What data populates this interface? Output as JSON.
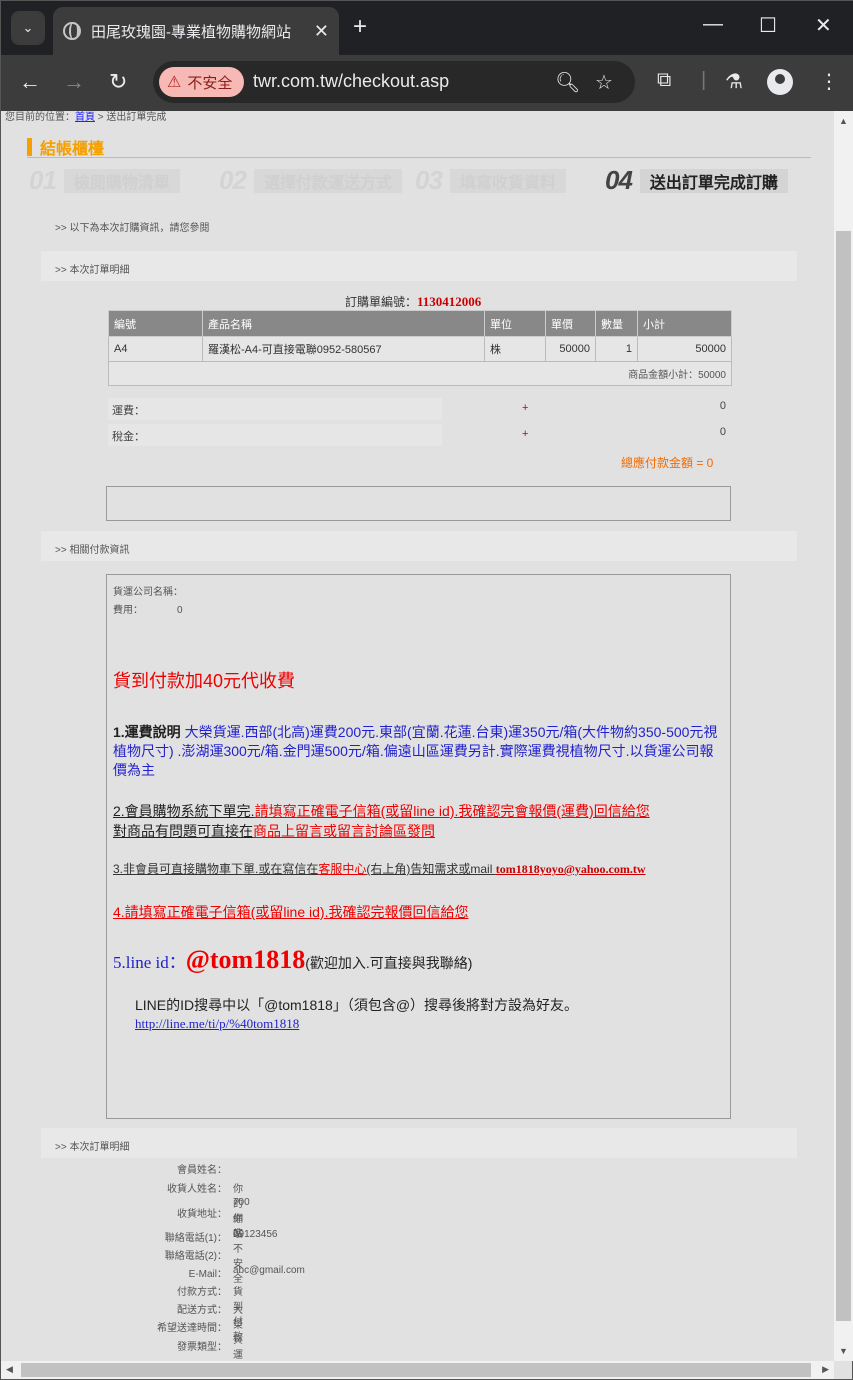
{
  "browser": {
    "tab_title": "田尾玫瑰園-專業植物購物網站",
    "not_secure_label": "不安全",
    "url": "twr.com.tw/checkout.asp"
  },
  "page": {
    "breadcrumb": {
      "prefix": "您目前的位置：",
      "home": "首頁",
      "suffix": " > 送出訂單完成"
    },
    "section_title": "結帳櫃檯",
    "steps": [
      {
        "num": "01",
        "label": "檢閱購物清單"
      },
      {
        "num": "02",
        "label": "選擇付款運送方式"
      },
      {
        "num": "03",
        "label": "填寫收貨資料"
      },
      {
        "num": "04",
        "label": "送出訂單完成訂購"
      }
    ],
    "notice": ">> 以下為本次訂購資訊，請您參閱",
    "order_band": ">> 本次訂單明細",
    "order_no_label": "訂購單編號：",
    "order_no": "1130412006",
    "table": {
      "headers": [
        "編號",
        "產品名稱",
        "單位",
        "單價",
        "數量",
        "小計"
      ],
      "rows": [
        {
          "code": "A4",
          "name": "羅漢松-A4-可直接電聯0952-580567",
          "unit": "株",
          "price": "50000",
          "qty": "1",
          "subtotal": "50000"
        }
      ],
      "items_total": "商品金額小計：50000"
    },
    "fees": [
      {
        "label": "運費：",
        "sign": "+",
        "value": "0"
      },
      {
        "label": "稅金：",
        "sign": "+",
        "value": "0"
      }
    ],
    "grand_total": "總應付款金額 = 0",
    "payment_band": ">> 相關付款資訊",
    "payment": {
      "carrier_label": "貨運公司名稱：",
      "fee_label": "費用：",
      "fee_value": "0",
      "cod_notice": "貨到付款加40元代收費",
      "p1_bold": "1.運費說明",
      "p1_text": " 大榮貨運.西部(北高)運費200元.東部(宜蘭.花蓮.台東)運350元/箱(大件物約350-500元視植物尺寸) .澎湖運300元/箱.金門運500元/箱.偏遠山區運費另計.實際運費視植物尺寸.以貨運公司報價為主",
      "p2_dark": "2.會員購物系統下單完.",
      "p2_red": "請填寫正確電子信箱(或留line id).我確認完會報價(運費)回信給您",
      "p2_line2_dark": "對商品有問題可直接在",
      "p2_line2_red": "商品上留言或留言討論區發問",
      "p3_dark": "3.非會員可直接購物車下單.或在寫信在",
      "p3_link": "客服中心",
      "p3_mid": "(右上角)告知需求或mail ",
      "p3_mail": "tom1818yoyo@yahoo.com.tw",
      "p4": "4.請填寫正確電子信箱(或留line id).我確認完報價回信給您",
      "p5_prefix": "5.line id：",
      "p5_id": "@tom1818",
      "p5_suffix": "(歡迎加入.可直接與我聯絡)",
      "line_help": "LINE的ID搜尋中以「@tom1818」（須包含@）搜尋後將對方設為好友。",
      "line_link": "http://line.me/ti/p/%40tom1818"
    },
    "detail_band": ">> 本次訂單明細",
    "details": [
      {
        "k": "會員姓名：",
        "v": ""
      },
      {
        "k": "收貨人姓名：",
        "v": "你的網站不安全"
      },
      {
        "k": "收貨地址：",
        "v": "700",
        "v2": "你家"
      },
      {
        "k": "聯絡電話(1)：",
        "v": "09123456"
      },
      {
        "k": "聯絡電話(2)：",
        "v": ""
      },
      {
        "k": "E-Mail：",
        "v": "abc@gmail.com"
      },
      {
        "k": "付款方式：",
        "v": "貨到付款"
      },
      {
        "k": "配送方式：",
        "v": "大榮貨運"
      },
      {
        "k": "希望送達時間：",
        "v": ""
      },
      {
        "k": "發票類型：",
        "v": ""
      }
    ]
  }
}
